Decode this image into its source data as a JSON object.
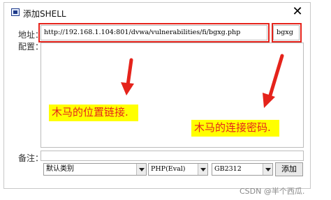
{
  "dialog": {
    "title": "添加SHELL",
    "close_label": "✕"
  },
  "form": {
    "address_label": "地址：",
    "config_label": "配置：",
    "url_value": "http://192.168.1.104:801/dvwa/vulnerabilities/fi/bgxg.php",
    "password_value": "bgxg",
    "note_label": "备注：",
    "note_value": "",
    "type_selected": "默认类别",
    "php_selected": "PHP(Eval)",
    "encoding_selected": "GB2312",
    "add_label": "添加"
  },
  "annotations": {
    "url_callout": "木马的位置链接.",
    "password_callout": "木马的连接密码.",
    "accent_color": "#e5231b",
    "highlight_color": "#ffff00"
  },
  "watermark": "CSDN @半个西瓜."
}
